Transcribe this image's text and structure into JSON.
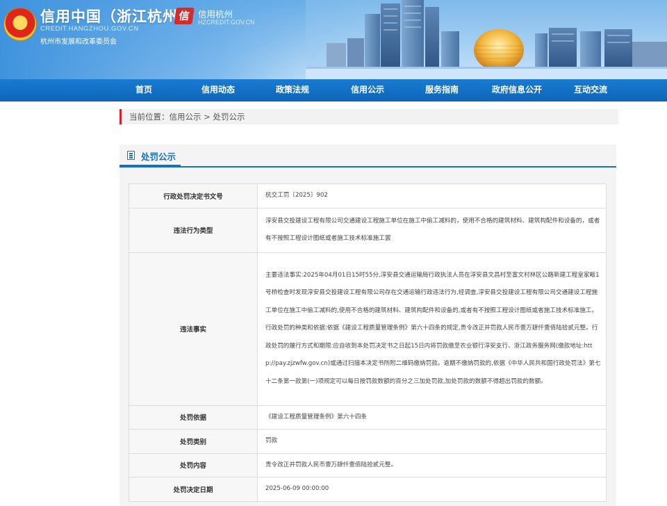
{
  "header": {
    "site_title": "信用中国（浙江杭州）",
    "site_domain": "CREDIT.HANGZHOU.GOV.CN",
    "site_org": "杭州市发展和改革委员会",
    "hz_logo_text": "信",
    "hz_title": "信用杭州",
    "hz_domain": "HZCREDIT.GOV.CN"
  },
  "nav": {
    "items": [
      {
        "label": "首页"
      },
      {
        "label": "信用动态"
      },
      {
        "label": "政策法规"
      },
      {
        "label": "信用公示"
      },
      {
        "label": "服务指南"
      },
      {
        "label": "政府信息公开"
      },
      {
        "label": "互动交流"
      }
    ]
  },
  "breadcrumb": {
    "prefix": "当前位置：",
    "items": [
      "信用公示",
      "处罚公示"
    ],
    "separator": " > "
  },
  "section": {
    "title": "处罚公示"
  },
  "detail": {
    "rows": [
      {
        "label": "行政处罚决定书文号",
        "value": "杭交工罚〔2025〕902"
      },
      {
        "label": "违法行为类型",
        "value": "淳安县交投建设工程有限公司交通建设工程施工单位在施工中偷工减料的，使用不合格的建筑材料、建筑构配件和设备的，或者有不按照工程设计图纸或者施工技术标准施工罢"
      },
      {
        "label": "违法事实",
        "value": "主要违法事实:2025年04月01日15时55分,淳安县交通运输局行政执法人员在淳安县文昌村至富文村林区公路新建工程皇家畈1号桥检查时发现淳安县交投建设工程有限公司存在交通运输行政违法行为,经调查,淳安县交投建设工程有限公司交通建设工程施工单位在施工中偷工减料的,使用不合格的建筑材料、建筑构配件和设备的,或者有不按照工程设计图纸或者施工技术标准施工。行政处罚的种类和依据:依据《建设工程质量管理条例》第六十四条的规定,责令改正并罚款人民币壹万肆仟壹佰陆拾贰元整。行政处罚的履行方式和期限:应自收到本处罚决定书之日起15日内将罚款缴至农业银行淳安支行、浙江政务服务网(缴款地址:http://pay.zjzwfw.gov.cn)或通过扫描本决定书所附二维码缴纳罚款。逾期不缴纳罚款的,依据《中华人民共和国行政处罚法》第七十二条第一款第(一)项规定可以每日按罚款数额的百分之三加处罚款,加处罚款的数额不得超出罚款的数额。"
      },
      {
        "label": "处罚依据",
        "value": "《建设工程质量管理条例》第六十四条"
      },
      {
        "label": "处罚类别",
        "value": "罚款"
      },
      {
        "label": "处罚内容",
        "value": "责令改正并罚款人民币壹万肆仟壹佰陆拾贰元整。"
      },
      {
        "label": "处罚决定日期",
        "value": "2025-06-09 00:00:00"
      }
    ]
  },
  "colors": {
    "nav_blue": "#0d66b9",
    "accent_blue": "#1470c3",
    "breadcrumb_red": "#d71f26"
  },
  "icons": {
    "emblem": "national-emblem-icon",
    "section": "document-icon"
  }
}
